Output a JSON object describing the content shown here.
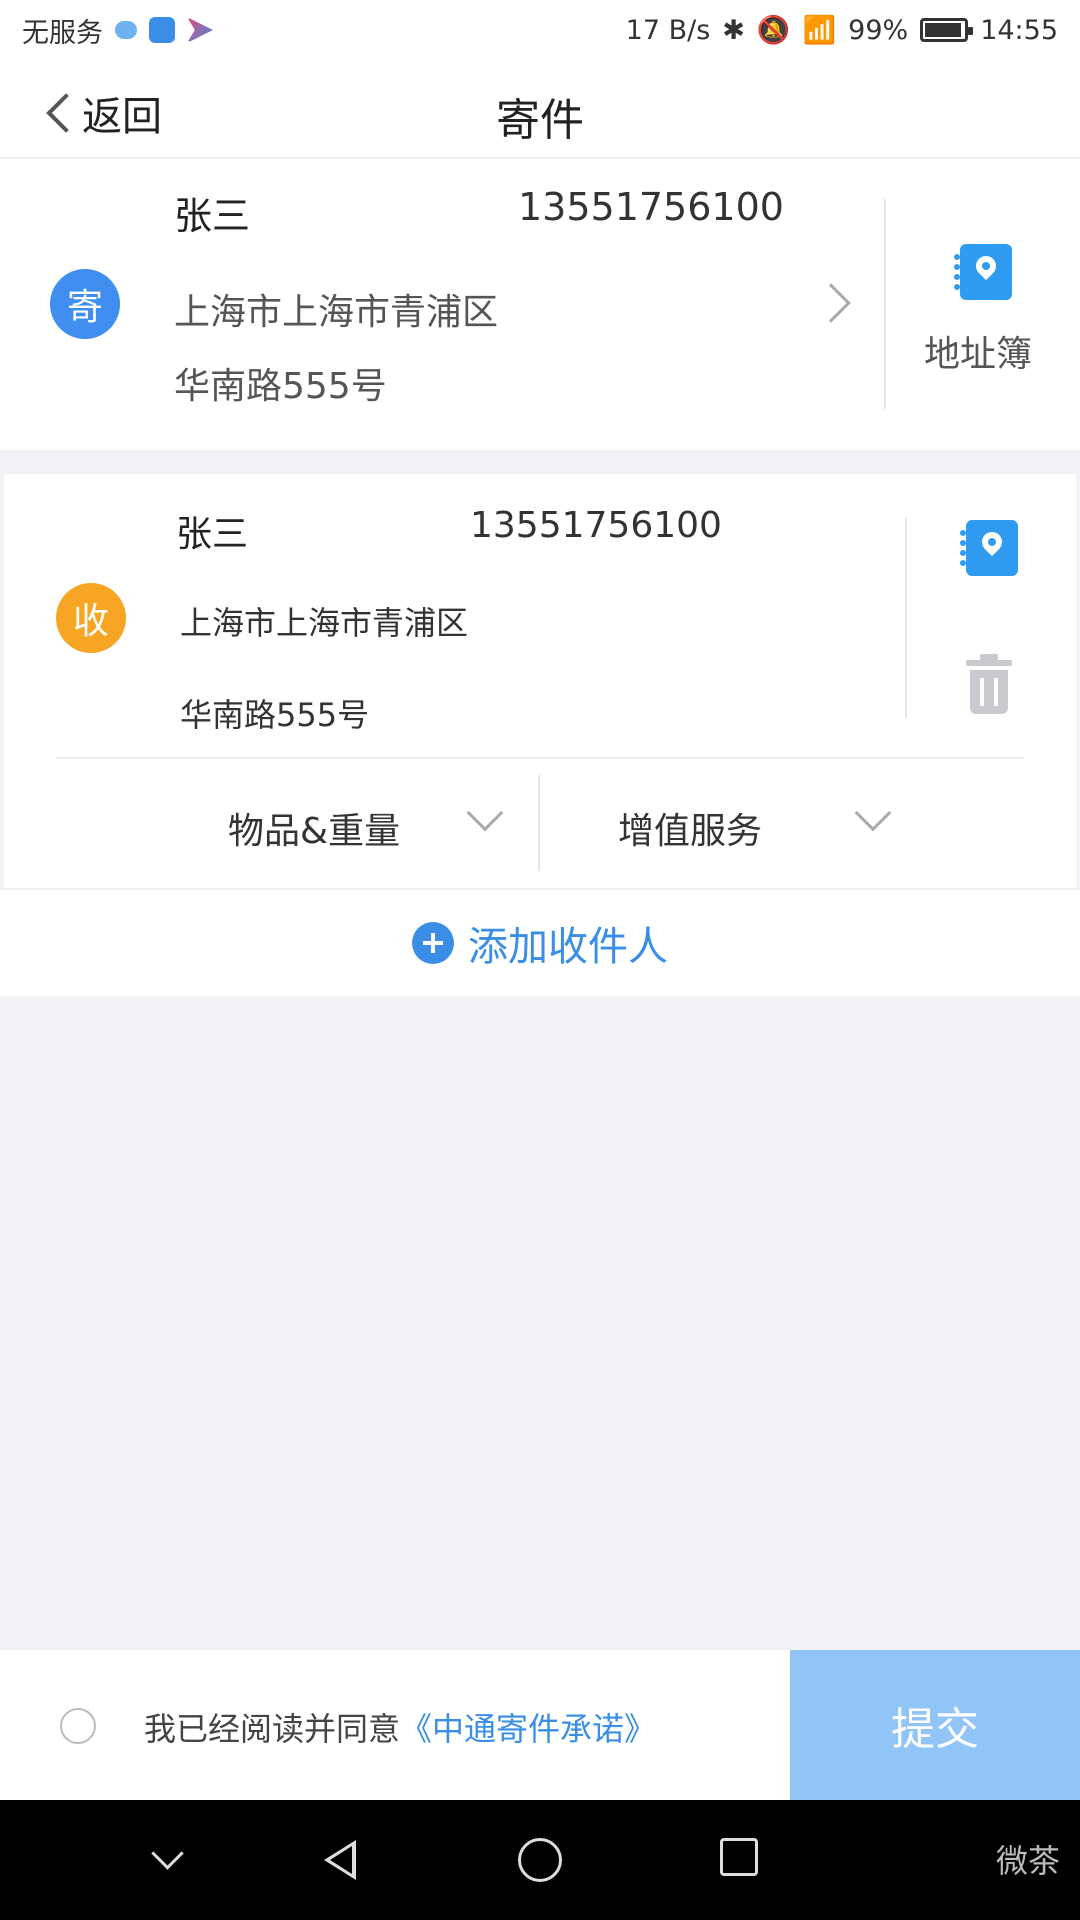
{
  "status_bar": {
    "carrier": "无服务",
    "speed": "17 B/s",
    "battery": "99%",
    "time": "14:55"
  },
  "nav": {
    "back_label": "返回",
    "title": "寄件"
  },
  "sender": {
    "badge": "寄",
    "name": "张三",
    "phone": "13551756100",
    "address_line1": "上海市上海市青浦区",
    "address_line2": "华南路555号",
    "address_book_label": "地址簿"
  },
  "receiver": {
    "badge": "收",
    "name": "张三",
    "phone": "13551756100",
    "address_line1": "上海市上海市青浦区",
    "address_line2": "华南路555号",
    "option_goods": "物品&重量",
    "option_service": "增值服务"
  },
  "add_recipient_label": "添加收件人",
  "bottom": {
    "agree_text": "我已经阅读并同意",
    "agree_link": "《中通寄件承诺》",
    "submit_label": "提交"
  },
  "watermark": "微茶"
}
